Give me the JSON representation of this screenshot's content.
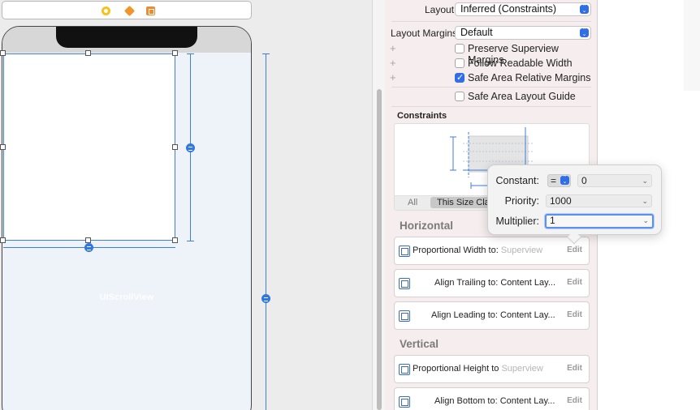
{
  "canvas": {
    "scroll_view_label": "UIScrollView",
    "scene_icons": [
      "view-controller-icon",
      "first-responder-icon",
      "exit-icon"
    ]
  },
  "inspector": {
    "layout_label": "Layout",
    "layout_value": "Inferred (Constraints)",
    "layout_margins_label": "Layout Margins",
    "layout_margins_value": "Default",
    "checkboxes": [
      {
        "label": "Preserve Superview Margins",
        "checked": false
      },
      {
        "label": "Follow Readable Width",
        "checked": false
      },
      {
        "label": "Safe Area Relative Margins",
        "checked": true
      },
      {
        "label": "Safe Area Layout Guide",
        "checked": false
      }
    ],
    "constraints_title": "Constraints",
    "scope_all": "All",
    "scope_this": "This Size Class",
    "horizontal_title": "Horizontal",
    "vertical_title": "Vertical",
    "horizontal_constraints": [
      {
        "label": "Proportional Width to:",
        "target": "Superview",
        "target_faint": true,
        "edit": "Edit"
      },
      {
        "label": "Align Trailing to:",
        "target": "Content Lay...",
        "target_faint": false,
        "edit": "Edit"
      },
      {
        "label": "Align Leading to:",
        "target": "Content Lay...",
        "target_faint": false,
        "edit": "Edit"
      }
    ],
    "vertical_constraints": [
      {
        "label": "Proportional Height to",
        "target": "Superview",
        "target_faint": true,
        "edit": "Edit"
      },
      {
        "label": "Align Bottom to:",
        "target": "Content Lay...",
        "target_faint": false,
        "edit": "Edit"
      }
    ]
  },
  "popover": {
    "constant_label": "Constant:",
    "relation": "=",
    "constant_value": "0",
    "priority_label": "Priority:",
    "priority_value": "1000",
    "multiplier_label": "Multiplier:",
    "multiplier_value": "1"
  },
  "colors": {
    "accent": "#2f6ee6",
    "selection_blue": "#3f7fd6",
    "inspector_bg": "#f6eeee"
  }
}
